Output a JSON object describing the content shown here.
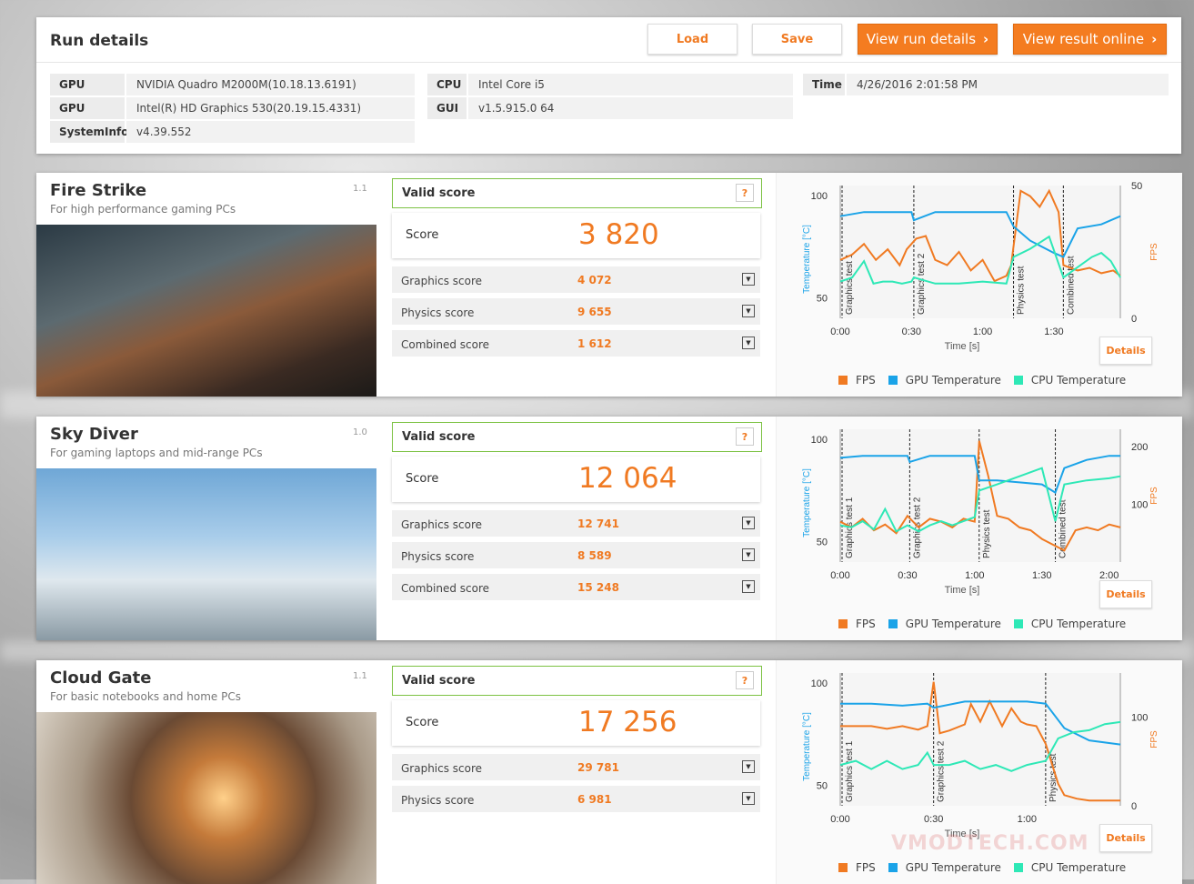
{
  "header": {
    "title": "Run details",
    "buttons": {
      "load": "Load",
      "save": "Save",
      "view_run_details": "View run details",
      "view_result_online": "View result online"
    }
  },
  "info": {
    "gpu1_key": "GPU",
    "gpu1_val": "NVIDIA Quadro M2000M(10.18.13.6191)",
    "gpu2_key": "GPU",
    "gpu2_val": "Intel(R) HD Graphics 530(20.19.15.4331)",
    "sysinfo_key": "SystemInfo",
    "sysinfo_val": "v4.39.552",
    "cpu_key": "CPU",
    "cpu_val": "Intel Core i5",
    "gui_key": "GUI",
    "gui_val": "v1.5.915.0 64",
    "time_key": "Time",
    "time_val": "4/26/2016 2:01:58 PM"
  },
  "legend": {
    "fps": "FPS",
    "gpu_temp": "GPU Temperature",
    "cpu_temp": "CPU Temperature"
  },
  "colors": {
    "fps": "#f07a22",
    "gpu": "#1aa3e8",
    "cpu": "#2ee8b6",
    "accent": "#f47c20",
    "valid_border": "#7cc243"
  },
  "common": {
    "valid": "Valid score",
    "help": "?",
    "score_label": "Score",
    "details": "Details",
    "ylabel_left": "Temperature [°C]",
    "ylabel_right": "FPS",
    "xlabel": "Time [s]"
  },
  "benchmarks": [
    {
      "name": "Fire Strike",
      "subtitle": "For high performance gaming PCs",
      "version": "1.1",
      "score": "3 820",
      "subs": [
        {
          "label": "Graphics score",
          "value": "4 072"
        },
        {
          "label": "Physics score",
          "value": "9 655"
        },
        {
          "label": "Combined score",
          "value": "1 612"
        }
      ]
    },
    {
      "name": "Sky Diver",
      "subtitle": "For gaming laptops and mid-range PCs",
      "version": "1.0",
      "score": "12 064",
      "subs": [
        {
          "label": "Graphics score",
          "value": "12 741"
        },
        {
          "label": "Physics score",
          "value": "8 589"
        },
        {
          "label": "Combined score",
          "value": "15 248"
        }
      ]
    },
    {
      "name": "Cloud Gate",
      "subtitle": "For basic notebooks and home PCs",
      "version": "1.1",
      "score": "17 256",
      "subs": [
        {
          "label": "Graphics score",
          "value": "29 781"
        },
        {
          "label": "Physics score",
          "value": "6 981"
        }
      ]
    }
  ],
  "chart_data": [
    {
      "type": "line",
      "title": "",
      "xlabel": "Time [s]",
      "ylabel": "Temperature [°C]",
      "y2label": "FPS",
      "x_ticks": [
        "0:00",
        "0:30",
        "1:00",
        "1:30"
      ],
      "y_ticks": [
        50,
        100
      ],
      "y2_ticks": [
        0,
        50
      ],
      "tests": [
        "Graphics test 1",
        "Graphics test 2",
        "Physics test",
        "Combined test"
      ],
      "series": [
        {
          "name": "FPS",
          "x": [
            0,
            5,
            10,
            15,
            20,
            25,
            28,
            32,
            36,
            40,
            45,
            50,
            55,
            60,
            65,
            70,
            72,
            76,
            80,
            84,
            88,
            92,
            94,
            100,
            105,
            110,
            115,
            118
          ],
          "y": [
            22,
            24,
            28,
            22,
            26,
            20,
            26,
            30,
            31,
            22,
            20,
            25,
            18,
            22,
            14,
            16,
            20,
            48,
            46,
            42,
            48,
            40,
            20,
            18,
            19,
            17,
            18,
            16
          ]
        },
        {
          "name": "GPU Temperature",
          "x": [
            0,
            10,
            20,
            30,
            31,
            40,
            50,
            60,
            70,
            73,
            80,
            90,
            94,
            100,
            110,
            118
          ],
          "y": [
            90,
            92,
            92,
            92,
            88,
            92,
            92,
            92,
            92,
            85,
            78,
            72,
            70,
            84,
            86,
            90
          ]
        },
        {
          "name": "CPU Temperature",
          "x": [
            0,
            5,
            10,
            14,
            18,
            22,
            26,
            30,
            31,
            40,
            50,
            60,
            70,
            73,
            80,
            88,
            94,
            100,
            106,
            110,
            114,
            118
          ],
          "y": [
            58,
            60,
            68,
            57,
            58,
            58,
            57,
            58,
            60,
            57,
            57,
            58,
            57,
            70,
            74,
            80,
            60,
            65,
            70,
            72,
            68,
            60
          ]
        }
      ]
    },
    {
      "type": "line",
      "title": "",
      "xlabel": "Time [s]",
      "ylabel": "Temperature [°C]",
      "y2label": "FPS",
      "x_ticks": [
        "0:00",
        "0:30",
        "1:00",
        "1:30",
        "2:00"
      ],
      "y_ticks": [
        50,
        100
      ],
      "y2_ticks": [
        100,
        200
      ],
      "tests": [
        "Graphics test 1",
        "Graphics test 2",
        "Physics test",
        "Combined test"
      ],
      "series": [
        {
          "name": "FPS",
          "x": [
            0,
            5,
            10,
            15,
            20,
            25,
            30,
            35,
            40,
            45,
            50,
            55,
            60,
            62,
            66,
            70,
            75,
            80,
            85,
            90,
            95,
            100,
            105,
            110,
            115,
            120,
            125
          ],
          "y": [
            70,
            60,
            75,
            55,
            65,
            50,
            80,
            60,
            75,
            70,
            60,
            75,
            70,
            210,
            150,
            80,
            75,
            60,
            55,
            40,
            30,
            20,
            55,
            60,
            55,
            65,
            60
          ]
        },
        {
          "name": "GPU Temperature",
          "x": [
            0,
            10,
            20,
            30,
            31,
            40,
            50,
            60,
            62,
            70,
            80,
            90,
            96,
            100,
            110,
            120,
            125
          ],
          "y": [
            91,
            92,
            92,
            92,
            89,
            92,
            92,
            92,
            80,
            80,
            79,
            78,
            74,
            86,
            90,
            92,
            92
          ]
        },
        {
          "name": "CPU Temperature",
          "x": [
            0,
            5,
            10,
            15,
            20,
            25,
            30,
            35,
            40,
            45,
            50,
            55,
            60,
            62,
            70,
            80,
            90,
            96,
            100,
            110,
            120,
            125
          ],
          "y": [
            58,
            57,
            60,
            56,
            66,
            55,
            58,
            55,
            58,
            60,
            58,
            60,
            62,
            75,
            78,
            82,
            86,
            60,
            78,
            80,
            81,
            82
          ]
        }
      ]
    },
    {
      "type": "line",
      "title": "",
      "xlabel": "Time [s]",
      "ylabel": "Temperature [°C]",
      "y2label": "FPS",
      "x_ticks": [
        "0:00",
        "0:30",
        "1:00"
      ],
      "y_ticks": [
        50,
        100
      ],
      "y2_ticks": [
        0,
        100
      ],
      "tests": [
        "Graphics test 1",
        "Graphics test 2",
        "Physics test"
      ],
      "series": [
        {
          "name": "FPS",
          "x": [
            0,
            5,
            10,
            15,
            20,
            25,
            28,
            30,
            32,
            35,
            40,
            42,
            45,
            48,
            52,
            55,
            58,
            60,
            63,
            66,
            70,
            72,
            76,
            80,
            85,
            90
          ],
          "y": [
            90,
            90,
            90,
            87,
            90,
            86,
            90,
            140,
            82,
            85,
            92,
            115,
            95,
            118,
            90,
            110,
            95,
            92,
            90,
            70,
            25,
            12,
            8,
            6,
            6,
            6
          ]
        },
        {
          "name": "GPU Temperature",
          "x": [
            0,
            10,
            20,
            28,
            30,
            40,
            50,
            60,
            66,
            72,
            80,
            90
          ],
          "y": [
            90,
            90,
            89,
            90,
            88,
            91,
            91,
            91,
            90,
            78,
            72,
            70
          ]
        },
        {
          "name": "CPU Temperature",
          "x": [
            0,
            5,
            10,
            15,
            20,
            25,
            28,
            30,
            35,
            40,
            45,
            50,
            55,
            60,
            66,
            70,
            75,
            80,
            85,
            90
          ],
          "y": [
            60,
            62,
            58,
            62,
            58,
            60,
            66,
            60,
            60,
            62,
            58,
            60,
            57,
            60,
            62,
            73,
            76,
            77,
            80,
            81
          ]
        }
      ]
    }
  ]
}
